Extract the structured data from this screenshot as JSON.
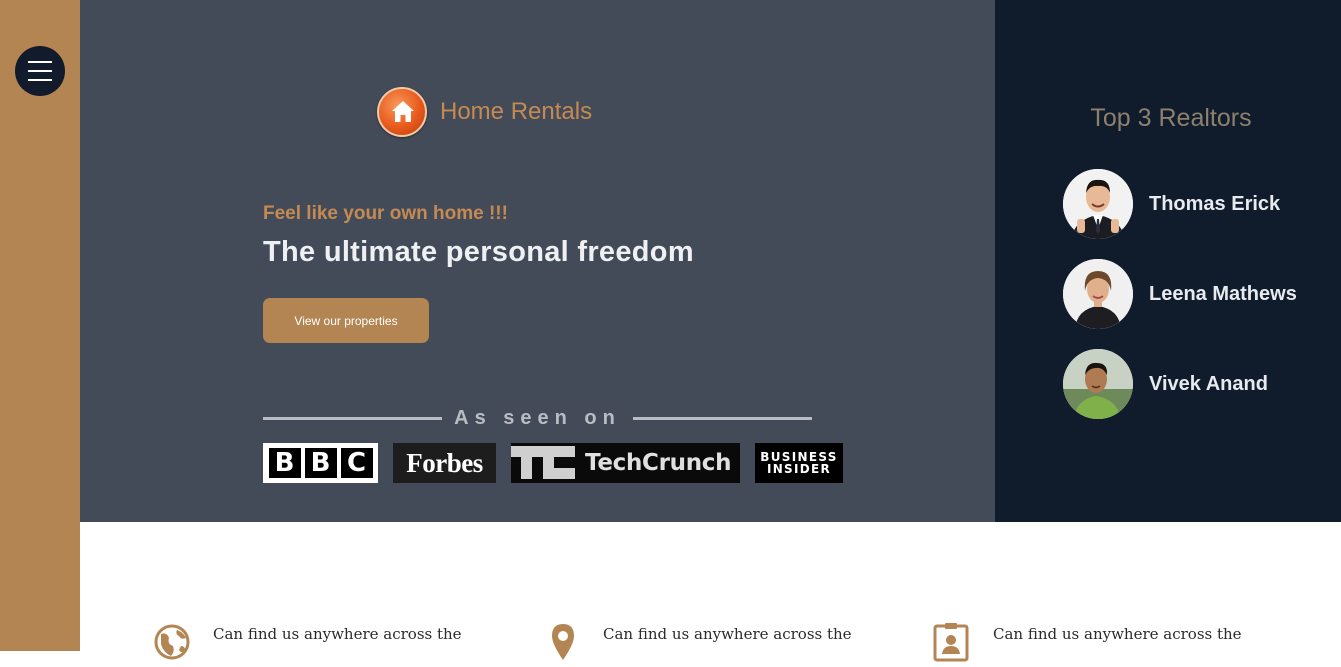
{
  "sidebar": {
    "menu_icon": "hamburger-menu-icon"
  },
  "brand": {
    "name": "Home Rentals",
    "logo_icon": "house-icon"
  },
  "hero": {
    "tagline": "Feel like your own home !!!",
    "headline": "The ultimate personal freedom",
    "cta_label": "View our properties",
    "seen_on_label": "As seen on",
    "press": {
      "bbc": [
        "B",
        "B",
        "C"
      ],
      "forbes": "Forbes",
      "techcrunch": "TechCrunch",
      "business_insider_line1": "BUSINESS",
      "business_insider_line2": "INSIDER"
    }
  },
  "realtors": {
    "title": "Top 3 Realtors",
    "items": [
      {
        "name": "Thomas Erick"
      },
      {
        "name": "Leena Mathews"
      },
      {
        "name": "Vivek Anand"
      }
    ]
  },
  "features": [
    {
      "icon": "globe-icon",
      "text": "Can find us anywhere across the"
    },
    {
      "icon": "map-pin-icon",
      "text": "Can find us anywhere across the"
    },
    {
      "icon": "contact-card-icon",
      "text": "Can find us anywhere across the"
    }
  ],
  "colors": {
    "accent": "#b38553",
    "hero_bg": "#434b58",
    "realtors_bg": "#101b2b",
    "brand_text": "#c58a52"
  }
}
